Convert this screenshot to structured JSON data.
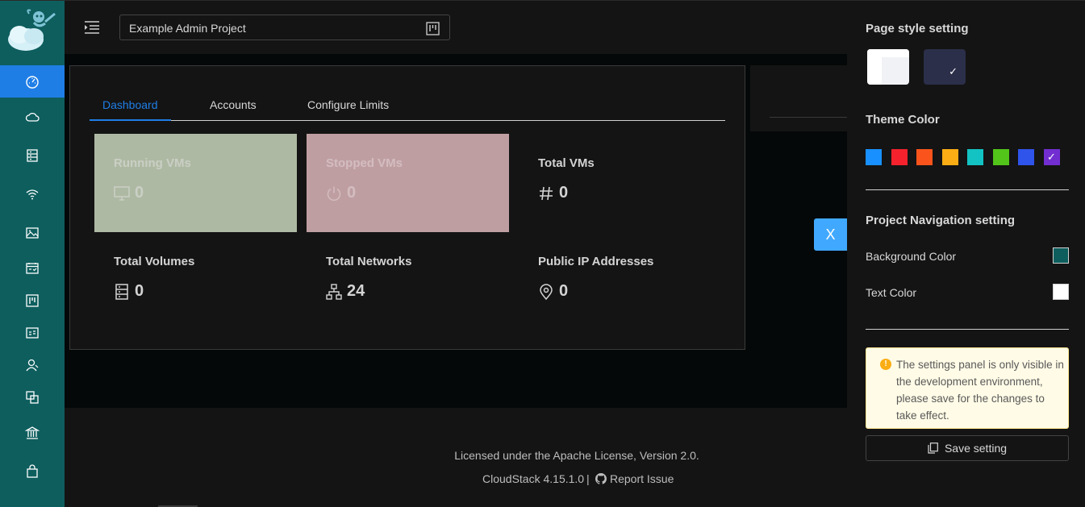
{
  "header": {
    "project_name": "Example Admin Project"
  },
  "sidebar": {
    "items": [
      {
        "icon": "dashboard-icon"
      },
      {
        "icon": "cloud-icon"
      },
      {
        "icon": "storage-icon"
      },
      {
        "icon": "wifi-icon"
      },
      {
        "icon": "picture-icon"
      },
      {
        "icon": "schedule-icon"
      },
      {
        "icon": "project-icon"
      },
      {
        "icon": "idcard-icon"
      },
      {
        "icon": "user-icon"
      },
      {
        "icon": "block-icon"
      },
      {
        "icon": "bank-icon"
      },
      {
        "icon": "shopping-icon"
      }
    ]
  },
  "tabs": [
    "Dashboard",
    "Accounts",
    "Configure Limits"
  ],
  "stats": {
    "running_vms": {
      "label": "Running VMs",
      "value": "0"
    },
    "stopped_vms": {
      "label": "Stopped VMs",
      "value": "0"
    },
    "total_vms": {
      "label": "Total VMs",
      "value": "0"
    },
    "total_volumes": {
      "label": "Total Volumes",
      "value": "0"
    },
    "total_networks": {
      "label": "Total Networks",
      "value": "24"
    },
    "public_ips": {
      "label": "Public IP Addresses",
      "value": "0"
    }
  },
  "close_label": "X",
  "footer": {
    "license": "Licensed under the Apache License, Version 2.0.",
    "version": "CloudStack 4.15.1.0",
    "separator": "|",
    "report": "Report Issue"
  },
  "settings": {
    "page_style_title": "Page style setting",
    "theme_color_title": "Theme Color",
    "theme_colors": [
      "#1890ff",
      "#f5222d",
      "#fa541c",
      "#faad14",
      "#13c2c2",
      "#52c41a",
      "#2f54eb",
      "#722ed1"
    ],
    "selected_theme_index": 7,
    "nav_title": "Project Navigation setting",
    "bg_color_label": "Background Color",
    "bg_color": "#0e5e5e",
    "text_color_label": "Text Color",
    "text_color": "#ffffff",
    "alert_text": "The settings panel is only visible in the development environment, please save for the changes to take effect.",
    "save_label": "Save setting",
    "check_mark": "✓"
  }
}
